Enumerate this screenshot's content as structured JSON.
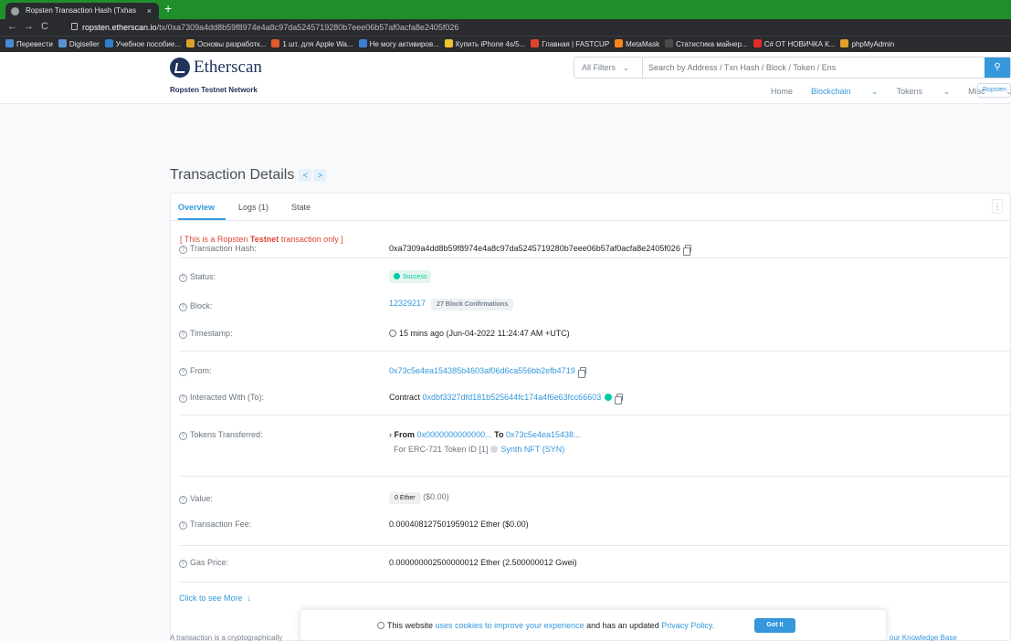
{
  "browser": {
    "tab_title": "Ropsten Transaction Hash (Txhas",
    "tab_close": "×",
    "new_tab": "+",
    "url_host": "ropsten.etherscan.io",
    "url_path": "/tx/0xa7309a4dd8b59f8974e4a8c97da5245719280b7eee06b57af0acfa8e2405f026",
    "bookmarks": [
      {
        "label": "Перевести",
        "color": "#4a8ad4"
      },
      {
        "label": "Digiseller",
        "color": "#5b8fd6"
      },
      {
        "label": "Учебное пособие...",
        "color": "#2f80c8"
      },
      {
        "label": "Основы разработк...",
        "color": "#e0a12c"
      },
      {
        "label": "1 шт. для Apple Wa...",
        "color": "#e05a2c"
      },
      {
        "label": "Не могу активиров...",
        "color": "#3d7fd6"
      },
      {
        "label": "Купить iPhone 4s/5...",
        "color": "#f1c232"
      },
      {
        "label": "Главная | FASTCUP",
        "color": "#e0442c"
      },
      {
        "label": "MetaMask",
        "color": "#f6851b"
      },
      {
        "label": "Статистика майнер...",
        "color": "#4b4b4b"
      },
      {
        "label": "C# ОТ НОВИЧКА К...",
        "color": "#e02c2c"
      },
      {
        "label": "phpMyAdmin",
        "color": "#e0a12c"
      }
    ]
  },
  "header": {
    "logo_text": "Etherscan",
    "network": "Ropsten Testnet Network",
    "filter_label": "All Filters",
    "search_placeholder": "Search by Address / Txn Hash / Block / Token / Ens",
    "nav": {
      "home": "Home",
      "blockchain": "Blockchain",
      "tokens": "Tokens",
      "misc": "Misc"
    },
    "net_pill": "Ropsten"
  },
  "page": {
    "title": "Transaction Details",
    "prev": "<",
    "next": ">",
    "tabs": {
      "overview": "Overview",
      "logs": "Logs (1)",
      "state": "State"
    },
    "notice_pre": "[ This is a Ropsten ",
    "notice_bold": "Testnet",
    "notice_post": " transaction only ]"
  },
  "details": {
    "hash_label": "Transaction Hash:",
    "hash": "0xa7309a4dd8b59f8974e4a8c97da5245719280b7eee06b57af0acfa8e2405f026",
    "status_label": "Status:",
    "status": "Success",
    "block_label": "Block:",
    "block": "12329217",
    "confirmations": "27 Block Confirmations",
    "timestamp_label": "Timestamp:",
    "timestamp": "15 mins ago (Jun-04-2022 11:24:47 AM +UTC)",
    "from_label": "From:",
    "from": "0x73c5e4ea154385b4603af06d6ca556bb2efb4719",
    "to_label": "Interacted With (To):",
    "to_prefix": "Contract",
    "to": "0xdbf3327dfd181b525644fc174a4f6e63fcc66603",
    "tokens_label": "Tokens Transferred:",
    "tok_from_word": "From",
    "tok_from": "0x0000000000000...",
    "tok_to_word": "To",
    "tok_to": "0x73c5e4ea15438...",
    "tok_for": "For ERC-721 Token ID [1]",
    "tok_name": "Synth NFT (SYN)",
    "value_label": "Value:",
    "value": "0 Ether",
    "value_usd": "($0.00)",
    "fee_label": "Transaction Fee:",
    "fee": "0.000408127501959012 Ether ($0.00)",
    "gas_label": "Gas Price:",
    "gas": "0.000000002500000012 Ether (2.500000012 Gwei)",
    "see_more": "Click to see More",
    "see_more_arrow": "↓"
  },
  "cookie": {
    "pre": "This website ",
    "link1": "uses cookies to improve your experience",
    "mid": " and has an updated ",
    "link2": "Privacy Policy.",
    "button": "Got It"
  },
  "footer": {
    "note": "A transaction is a cryptographically",
    "kb": "our Knowledge Base"
  }
}
